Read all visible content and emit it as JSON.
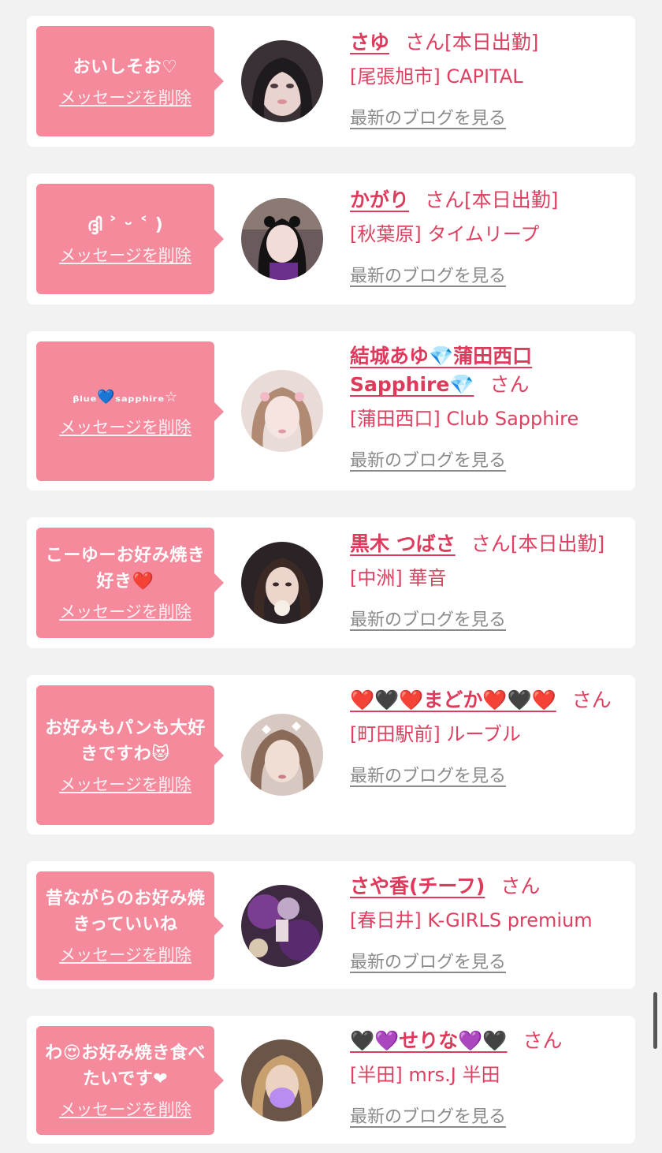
{
  "delete_label": "メッセージを削除",
  "blog_label": "最新のブログを見る",
  "san_label": "さん",
  "cards": [
    {
      "message": "おいしそお♡",
      "name": "さゆ",
      "status": "[本日出勤]",
      "shop": "[尾張旭市] CAPITAL"
    },
    {
      "message": "ദ്ദി ˃ ᵕ ˂ )",
      "name": "かがり",
      "status": "[本日出勤]",
      "shop": "[秋葉原] タイムリープ"
    },
    {
      "message": "ᵦₗᵤₑ💙ₛₐₚₚₕᵢᵣₑ☆",
      "name": "結城あゆ💎蒲田西口Sapphire💎",
      "status": "",
      "shop": "[蒲田西口] Club Sapphire"
    },
    {
      "message": "こーゆーお好み焼き好き❤️",
      "name": "黒木 つばさ",
      "status": "[本日出勤]",
      "shop": "[中洲] 華音"
    },
    {
      "message": "お好みもパンも大好きですわ😻",
      "name": "❤️🖤❤️まどか❤️🖤❤️",
      "status": "",
      "shop": "[町田駅前] ルーブル"
    },
    {
      "message": "昔ながらのお好み焼きっていいね",
      "name": "さや香(チーフ)",
      "status": "",
      "shop": "[春日井] K-GIRLS premium"
    },
    {
      "message": "わ😍お好み焼き食べたいです❤",
      "name": "🖤💜せりな💜🖤",
      "status": "",
      "shop": "[半田] mrs.J 半田"
    }
  ],
  "colors": {
    "accent": "#dd4060",
    "bubble": "#f48a9c",
    "background": "#f2f2f2",
    "link_gray": "#8a8a8a"
  }
}
